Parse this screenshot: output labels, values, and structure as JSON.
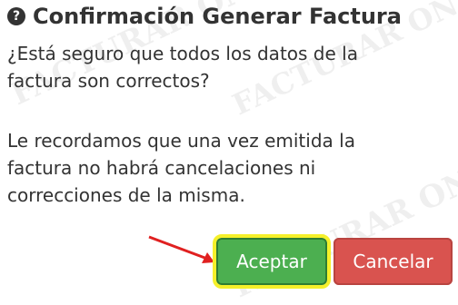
{
  "dialog": {
    "title": "Confirmación Generar Factura",
    "title_icon": "question-circle-icon",
    "message_1": "¿Está seguro que todos los datos de la factura son correctos?",
    "message_2": "Le recordamos que una vez emitida la factura no habrá cancelaciones ni correcciones de la misma."
  },
  "buttons": {
    "accept_label": "Aceptar",
    "cancel_label": "Cancelar"
  },
  "watermark": {
    "text_1": "FACTURAR ONLINE",
    "text_2": "FACTURAR ONLINE",
    "text_3": "FACTURAR ONLINE"
  },
  "colors": {
    "accept": "#4caf50",
    "cancel": "#d9534f",
    "highlight": "#f5f02a",
    "arrow": "#e02020"
  }
}
